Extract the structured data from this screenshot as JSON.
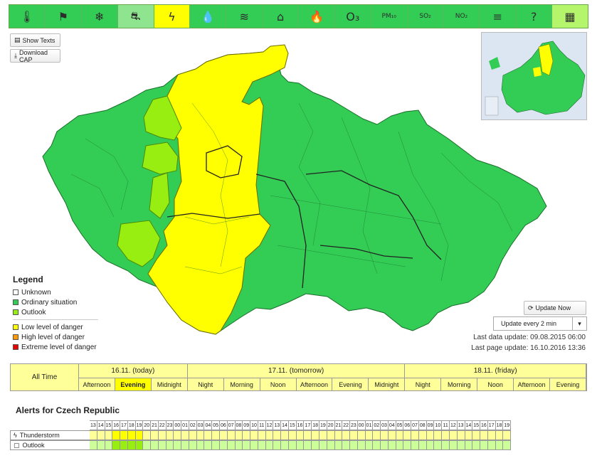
{
  "toolbar": {
    "items": [
      {
        "name": "temperature-icon",
        "glyph": "🌡",
        "state": "normal"
      },
      {
        "name": "wind-icon",
        "glyph": "⚑",
        "state": "normal"
      },
      {
        "name": "snow-icon",
        "glyph": "❄",
        "state": "normal"
      },
      {
        "name": "road-icy-icon",
        "glyph": "⛐",
        "state": "selected"
      },
      {
        "name": "thunderstorm-icon",
        "glyph": "ϟ",
        "state": "warning"
      },
      {
        "name": "rain-icon",
        "glyph": "💧",
        "state": "normal"
      },
      {
        "name": "flood-icon",
        "glyph": "≋",
        "state": "normal"
      },
      {
        "name": "flood-warning-icon",
        "glyph": "⌂",
        "state": "normal"
      },
      {
        "name": "fire-icon",
        "glyph": "🔥",
        "state": "normal"
      },
      {
        "name": "ozone-icon",
        "glyph": "O₃",
        "state": "normal"
      },
      {
        "name": "pm10-icon",
        "glyph": "PM₁₀",
        "state": "normal"
      },
      {
        "name": "so2-icon",
        "glyph": "SO₂",
        "state": "normal"
      },
      {
        "name": "no2-icon",
        "glyph": "NO₂",
        "state": "normal"
      },
      {
        "name": "fog-icon",
        "glyph": "≡",
        "state": "normal"
      },
      {
        "name": "help-icon",
        "glyph": "?",
        "state": "normal"
      },
      {
        "name": "calendar-icon",
        "glyph": "▦",
        "state": "calendar"
      }
    ]
  },
  "buttons": {
    "show_texts": "Show Texts",
    "download_cap": "Download CAP",
    "update_now": "Update Now"
  },
  "legend": {
    "title": "Legend",
    "items": [
      {
        "label": "Unknown",
        "color": "#ffffff"
      },
      {
        "label": "Ordinary situation",
        "color": "#33cc55"
      },
      {
        "label": "Outlook",
        "color": "#99ee11"
      },
      {
        "label": "Low level of danger",
        "color": "#ffff00"
      },
      {
        "label": "High level of danger",
        "color": "#ff9900"
      },
      {
        "label": "Extreme level of danger",
        "color": "#ee0000"
      }
    ]
  },
  "update": {
    "interval": "Update every 2 min",
    "last_data_label": "Last data update:",
    "last_data_value": "09.08.2015 06:00",
    "last_page_label": "Last page update:",
    "last_page_value": "16.10.2016 13:36"
  },
  "timetable": {
    "all_time": "All Time",
    "days": [
      {
        "label": "16.11. (today)",
        "periods": [
          "Afternoon",
          "Evening",
          "Midnight"
        ],
        "current": 1
      },
      {
        "label": "17.11. (tomorrow)",
        "periods": [
          "Night",
          "Morning",
          "Noon",
          "Afternoon",
          "Evening",
          "Midnight"
        ],
        "current": -1
      },
      {
        "label": "18.11. (friday)",
        "periods": [
          "Night",
          "Morning",
          "Noon",
          "Afternoon",
          "Evening"
        ],
        "current": -1
      }
    ]
  },
  "alerts": {
    "title": "Alerts for Czech Republic",
    "hours": [
      "13",
      "14",
      "15",
      "16",
      "17",
      "18",
      "19",
      "20",
      "21",
      "22",
      "23",
      "00",
      "01",
      "02",
      "03",
      "04",
      "05",
      "06",
      "07",
      "08",
      "09",
      "10",
      "11",
      "12",
      "13",
      "14",
      "15",
      "16",
      "17",
      "18",
      "19",
      "20",
      "21",
      "22",
      "23",
      "00",
      "01",
      "02",
      "03",
      "04",
      "05",
      "06",
      "07",
      "08",
      "09",
      "10",
      "11",
      "12",
      "13",
      "14",
      "15",
      "16",
      "17",
      "18",
      "19"
    ],
    "rows": [
      {
        "label": "Thunderstorm",
        "icon": "thunderstorm-icon",
        "glyph": "ϟ",
        "levels": "yyyyyyyyyyyyyyyyyyyyyyyyyyyyyyyyyyyyyyyyyyyyyyyyyyyyyyy",
        "highlight": [
          3,
          4,
          5,
          6
        ]
      },
      {
        "label": "Outlook",
        "icon": "outlook-icon",
        "glyph": "▢",
        "levels": "ooooooooooooooooooooooooooooooooooooooooooooooooooooooo",
        "highlight": [
          3,
          4,
          5,
          6
        ]
      }
    ],
    "colors": {
      "y": "#ffff99",
      "yh": "#ffff00",
      "o": "#ccff99",
      "oh": "#99ee11"
    }
  }
}
